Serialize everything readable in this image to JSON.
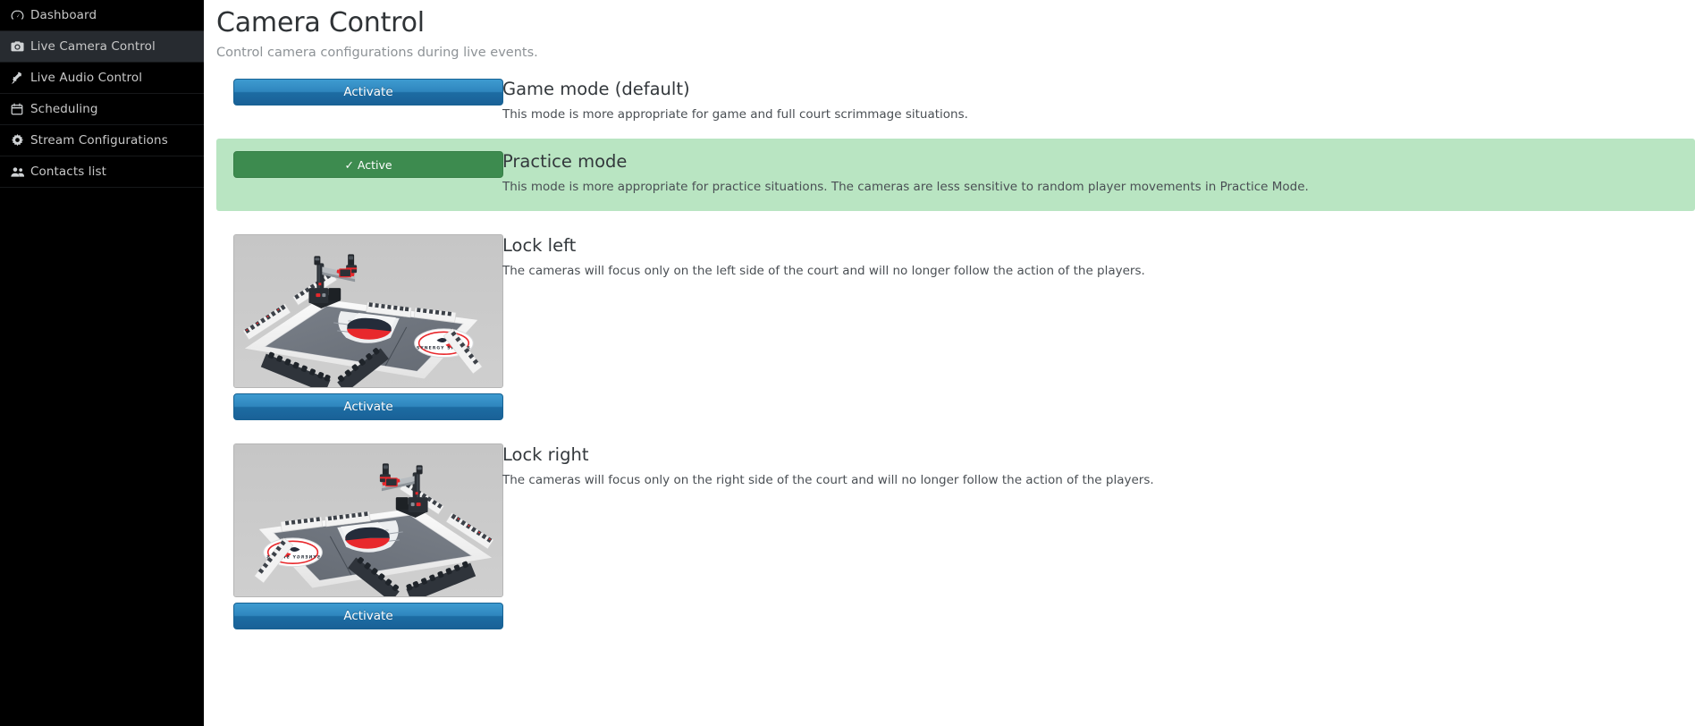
{
  "sidebar": {
    "items": [
      {
        "id": "dashboard",
        "label": "Dashboard",
        "icon": "gauge-icon",
        "active": false
      },
      {
        "id": "camera",
        "label": "Live Camera Control",
        "icon": "camera-icon",
        "active": true
      },
      {
        "id": "audio",
        "label": "Live Audio Control",
        "icon": "mic-icon",
        "active": false
      },
      {
        "id": "scheduling",
        "label": "Scheduling",
        "icon": "calendar-icon",
        "active": false
      },
      {
        "id": "streams",
        "label": "Stream Configurations",
        "icon": "gear-icon",
        "active": false
      },
      {
        "id": "contacts",
        "label": "Contacts list",
        "icon": "users-icon",
        "active": false
      }
    ]
  },
  "header": {
    "title": "Camera Control",
    "subtitle": "Control camera configurations during live events."
  },
  "modes": [
    {
      "id": "game-mode",
      "title": "Game mode (default)",
      "description": "This mode is more appropriate for game and full court scrimmage situations.",
      "button_label": "Activate",
      "state": "inactive",
      "has_thumbnail": false
    },
    {
      "id": "practice-mode",
      "title": "Practice mode",
      "description": "This mode is more appropriate for practice situations. The cameras are less sensitive to random player movements in Practice Mode.",
      "button_label": "✓ Active",
      "state": "active",
      "has_thumbnail": false
    },
    {
      "id": "lock-left",
      "title": "Lock left",
      "description": "The cameras will focus only on the left side of the court and will no longer follow the action of the players.",
      "button_label": "Activate",
      "state": "inactive",
      "has_thumbnail": true,
      "thumbnail_name": "court-camera-left-render"
    },
    {
      "id": "lock-right",
      "title": "Lock right",
      "description": "The cameras will focus only on the right side of the court and will no longer follow the action of the players.",
      "button_label": "Activate",
      "state": "inactive",
      "has_thumbnail": true,
      "thumbnail_name": "court-camera-right-render"
    }
  ],
  "colors": {
    "sidebar_bg": "#000000",
    "sidebar_active_bg": "#272b30",
    "accent_blue": "#2f86be",
    "active_green": "#3d8b4f",
    "highlight_green": "#b9e5c2",
    "title_text": "#33383c",
    "muted_text": "#8d9296"
  },
  "court_render": {
    "logo_text": "SYNERGY SPORTS",
    "floor_color": "#6e747d",
    "key_color": "#e9eaec",
    "logo_red": "#e8282c",
    "logo_navy": "#242c3a"
  }
}
